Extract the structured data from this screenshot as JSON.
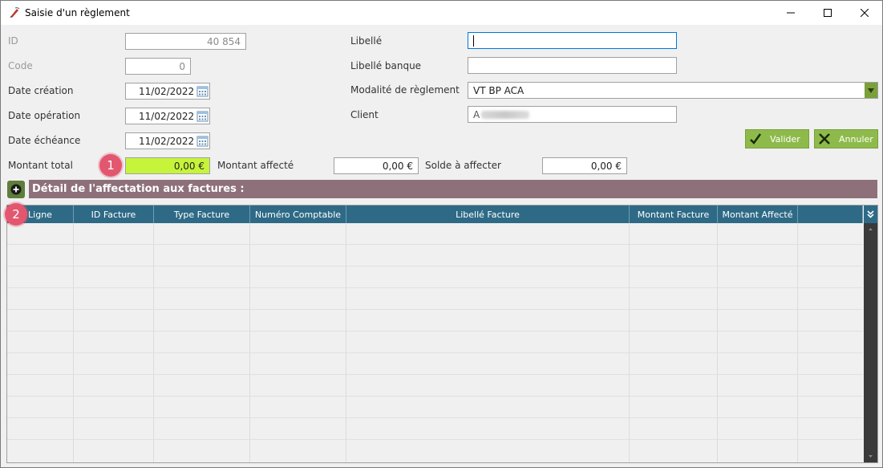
{
  "window": {
    "title": "Saisie d'un règlement"
  },
  "form": {
    "id": {
      "label": "ID",
      "value": "40 854"
    },
    "code": {
      "label": "Code",
      "value": "0"
    },
    "date_creation": {
      "label": "Date création",
      "value": "11/02/2022"
    },
    "date_operation": {
      "label": "Date opération",
      "value": "11/02/2022"
    },
    "date_echeance": {
      "label": "Date échéance",
      "value": "11/02/2022"
    },
    "libelle": {
      "label": "Libellé",
      "value": ""
    },
    "libelle_banque": {
      "label": "Libellé banque",
      "value": ""
    },
    "modalite": {
      "label": "Modalité de règlement",
      "value": "VT BP ACA"
    },
    "client": {
      "label": "Client",
      "value": "A"
    },
    "montant_total": {
      "label": "Montant total",
      "value": "0,00 €"
    },
    "montant_affecte": {
      "label": "Montant affecté",
      "value": "0,00 €"
    },
    "solde": {
      "label": "Solde à affecter",
      "value": "0,00 €"
    }
  },
  "buttons": {
    "valider": "Valider",
    "annuler": "Annuler"
  },
  "badges": {
    "one": "1",
    "two": "2"
  },
  "section": {
    "title": "Détail de l'affectation aux factures :"
  },
  "table": {
    "columns": [
      "Ligne",
      "ID Facture",
      "Type Facture",
      "Numéro Comptable",
      "Libellé Facture",
      "Montant Facture",
      "Montant Affecté",
      ""
    ]
  },
  "colors": {
    "accent_green": "#8eba4b",
    "highlight_field": "#c6f43a",
    "header_blue": "#2e6a86",
    "section_bar": "#8d7079",
    "badge_pink": "#e2576f"
  }
}
